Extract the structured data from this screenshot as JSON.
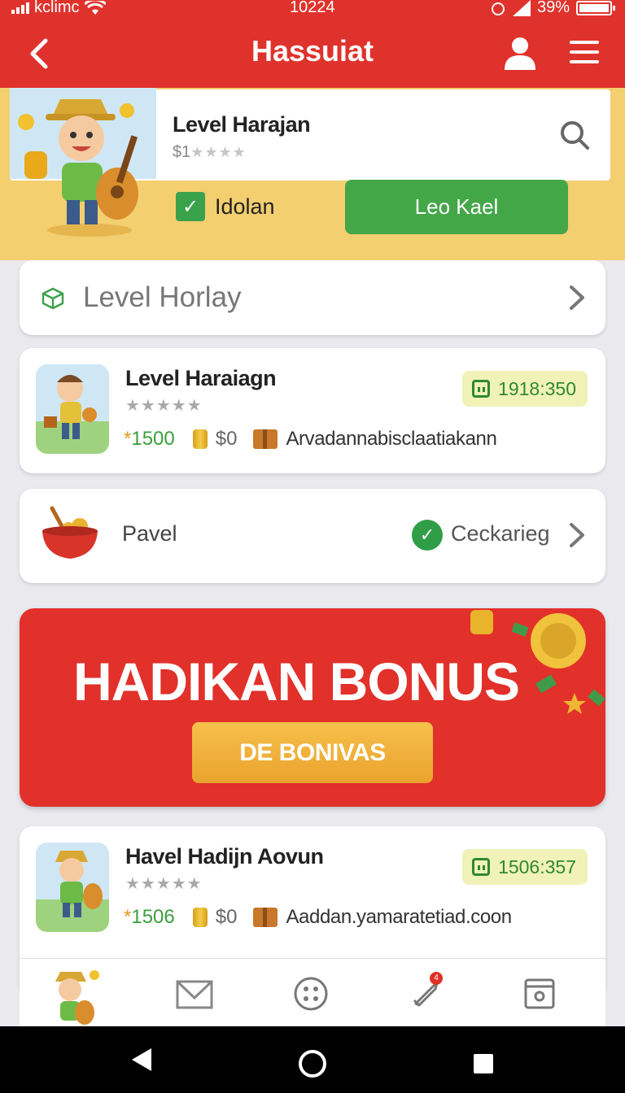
{
  "status_bar": {
    "carrier": "kclimc",
    "time": "10224",
    "battery": "39%"
  },
  "header": {
    "title": "Hassuiat",
    "back_icon": "chevron-left-icon",
    "profile_icon": "user-icon",
    "menu_icon": "menu-icon"
  },
  "hero": {
    "title": "Level Harajan",
    "price": "$1",
    "stars": "★★★★",
    "search_icon": "search-icon",
    "checkbox_label": "Idolan",
    "checkbox_checked": true,
    "button_label": "Leo Kael",
    "colors": {
      "background": "#f3cf70",
      "button": "#43a647"
    }
  },
  "search_row": {
    "placeholder": "Level Horlay",
    "icon": "cube-icon"
  },
  "games": [
    {
      "name": "Level Haraiagn",
      "rating": "★★★★★",
      "points": "1500",
      "price": "$0",
      "site": "Arvadannabisclaatiakann",
      "code": "1918:350"
    },
    {
      "name": "Havel Hadijn Aovun",
      "rating": "★★★★★",
      "points": "1506",
      "price": "$0",
      "site": "Aaddan.yamaratetiad.coon",
      "code": "1506:357"
    }
  ],
  "pavel_row": {
    "label": "Pavel",
    "status": "Ceckarieg",
    "status_icon": "check-circle-icon"
  },
  "banner": {
    "headline": "HADIKAN BONUS",
    "button_label": "DE BONIVAS",
    "colors": {
      "background": "#e2302a",
      "button": "#f0b13c"
    }
  },
  "bottom_nav": {
    "items": [
      "home-avatar-icon",
      "mail-icon",
      "dots-icon",
      "rocket-icon",
      "archive-icon"
    ],
    "badge": "4"
  },
  "system_nav": {
    "items": [
      "back-triangle-icon",
      "home-circle-icon",
      "recents-square-icon"
    ]
  },
  "colors": {
    "header": "#e0322c",
    "accent_green": "#3aa24a"
  }
}
